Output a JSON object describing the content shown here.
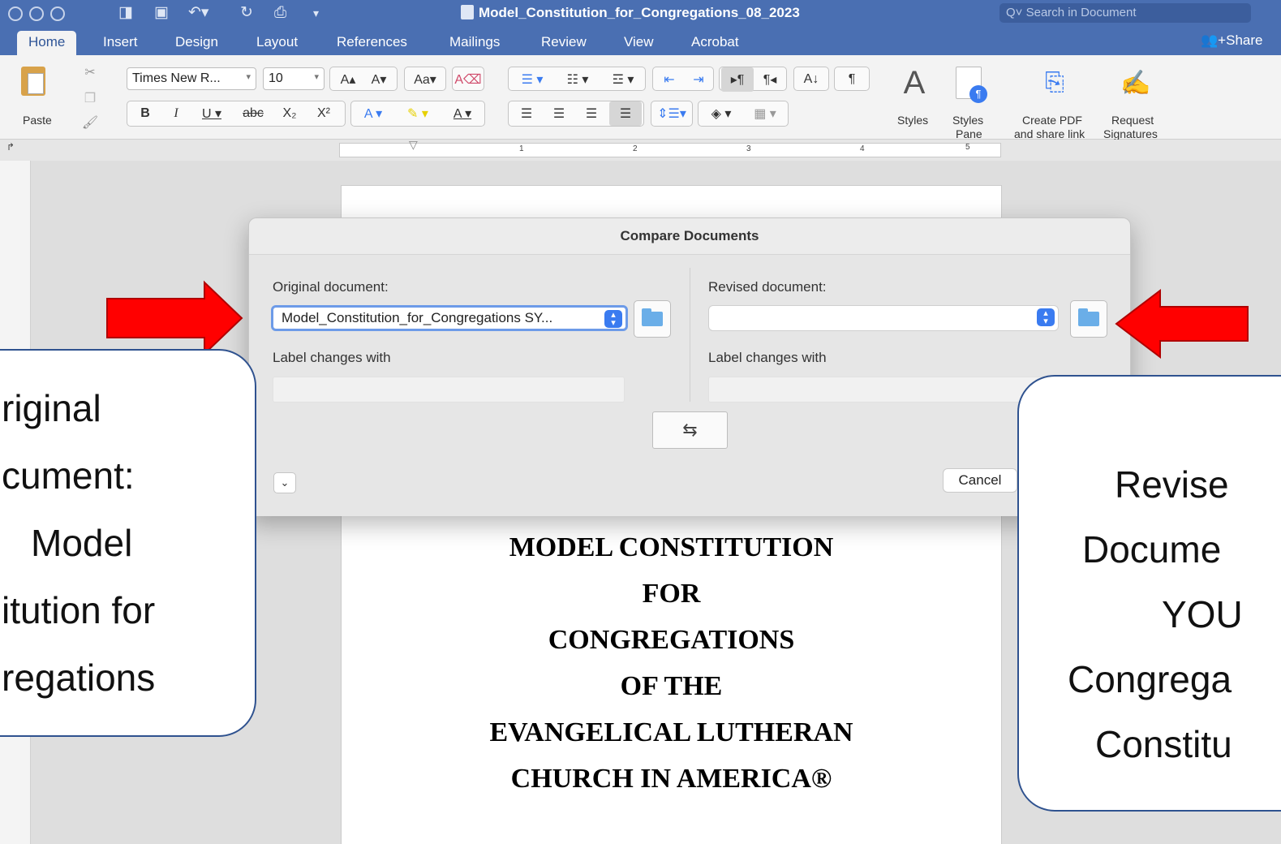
{
  "window": {
    "title": "Model_Constitution_for_Congregations_08_2023",
    "search_placeholder": "Search in Document"
  },
  "ribbon_tabs": [
    "Home",
    "Insert",
    "Design",
    "Layout",
    "References",
    "Mailings",
    "Review",
    "View",
    "Acrobat"
  ],
  "share_label": "Share",
  "ribbon": {
    "paste_label": "Paste",
    "font_name": "Times New R...",
    "font_size": "10",
    "styles_label": "Styles",
    "styles_pane_label_1": "Styles",
    "styles_pane_label_2": "Pane",
    "create_pdf_1": "Create PDF",
    "create_pdf_2": "and share link",
    "request_sig_1": "Request",
    "request_sig_2": "Signatures",
    "ruler_numbers": [
      "1",
      "2",
      "3",
      "4",
      "5"
    ]
  },
  "document": {
    "lines": [
      "MODEL CONSTITUTION",
      "FOR",
      "CONGREGATIONS",
      "OF THE",
      "EVANGELICAL LUTHERAN",
      "CHURCH IN AMERICA®"
    ]
  },
  "dialog": {
    "title": "Compare Documents",
    "original_label": "Original document:",
    "original_value": "Model_Constitution_for_Congregations SY...",
    "revised_label": "Revised document:",
    "revised_value": "",
    "label_changes_left": "Label changes with",
    "label_changes_right": "Label changes with",
    "cancel": "Cancel"
  },
  "callouts": {
    "left": [
      "riginal",
      "cument:",
      "Model",
      "itution for",
      "regations"
    ],
    "right": [
      "Revise",
      "Docume",
      "YOU",
      "Congrega",
      "Constitu"
    ]
  },
  "colors": {
    "accent": "#4a6fb2",
    "arrow_red": "#ff0000",
    "callout_border": "#2f528f",
    "focus_ring": "#6d9be8"
  }
}
